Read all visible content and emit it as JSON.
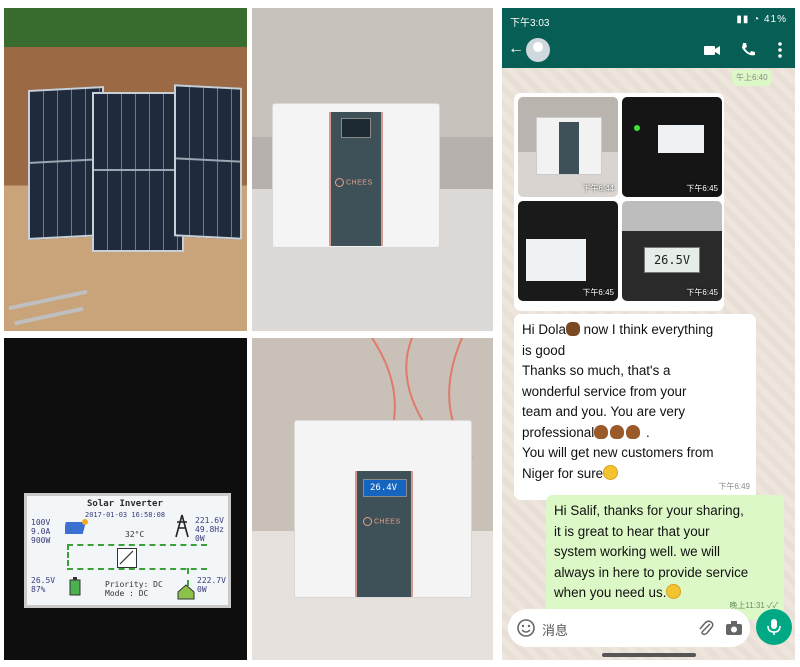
{
  "collage": {
    "photo1": {
      "name": "solar-panels-photo"
    },
    "photo2": {
      "name": "battery-cabinet-indoor-photo",
      "brand": "CHEES"
    },
    "photo3": {
      "name": "inverter-lcd-photo",
      "lcd": {
        "title": "Solar Inverter",
        "datetime": "2017-01-03 16:58:08",
        "pv_voltage": "100V",
        "pv_current": "9.0A",
        "pv_power": "900W",
        "temperature": "32°C",
        "grid_voltage": "221.6V",
        "grid_freq": "49.8Hz",
        "grid_power": "0W",
        "battery_voltage": "26.5V",
        "battery_percent": "87%",
        "load_voltage": "222.7V",
        "load_power": "0W",
        "priority": "Priority: DC",
        "mode": "Mode : DC"
      }
    },
    "photo4": {
      "name": "battery-cabinet-installed-photo",
      "brand": "CHEES",
      "screen_value": "26.4V"
    }
  },
  "phone": {
    "status": {
      "time": "下午3:03",
      "battery": "41"
    },
    "peek_time": "午上6:40",
    "images": [
      {
        "time": "下午6:44"
      },
      {
        "time": "下午6:45"
      },
      {
        "time": "下午6:45"
      },
      {
        "time": "下午6:45",
        "reading": "26.5V"
      }
    ],
    "incoming": {
      "line1a": "Hi Dola",
      "line1b": " now I think everything",
      "line2": "is good",
      "line3": "Thanks so much, that's a",
      "line4": "wonderful service from your",
      "line5": "team and you. You are very",
      "line6a": "professional",
      "line6b": " .",
      "line7": "You will get new customers from",
      "line8": "Niger for sure",
      "time": "下午6:49"
    },
    "outgoing": {
      "line1": "Hi Salif, thanks for your sharing,",
      "line2": "it is great to hear that your",
      "line3": "system working well. we will",
      "line4": "always in here to provide service",
      "line5": "when you need us.",
      "time": "晚上11:31 ✓✓"
    },
    "composer": {
      "placeholder": "消息"
    },
    "colors": {
      "header": "#075e54",
      "outgoing": "#dcf8c6",
      "mic": "#00a884"
    }
  }
}
